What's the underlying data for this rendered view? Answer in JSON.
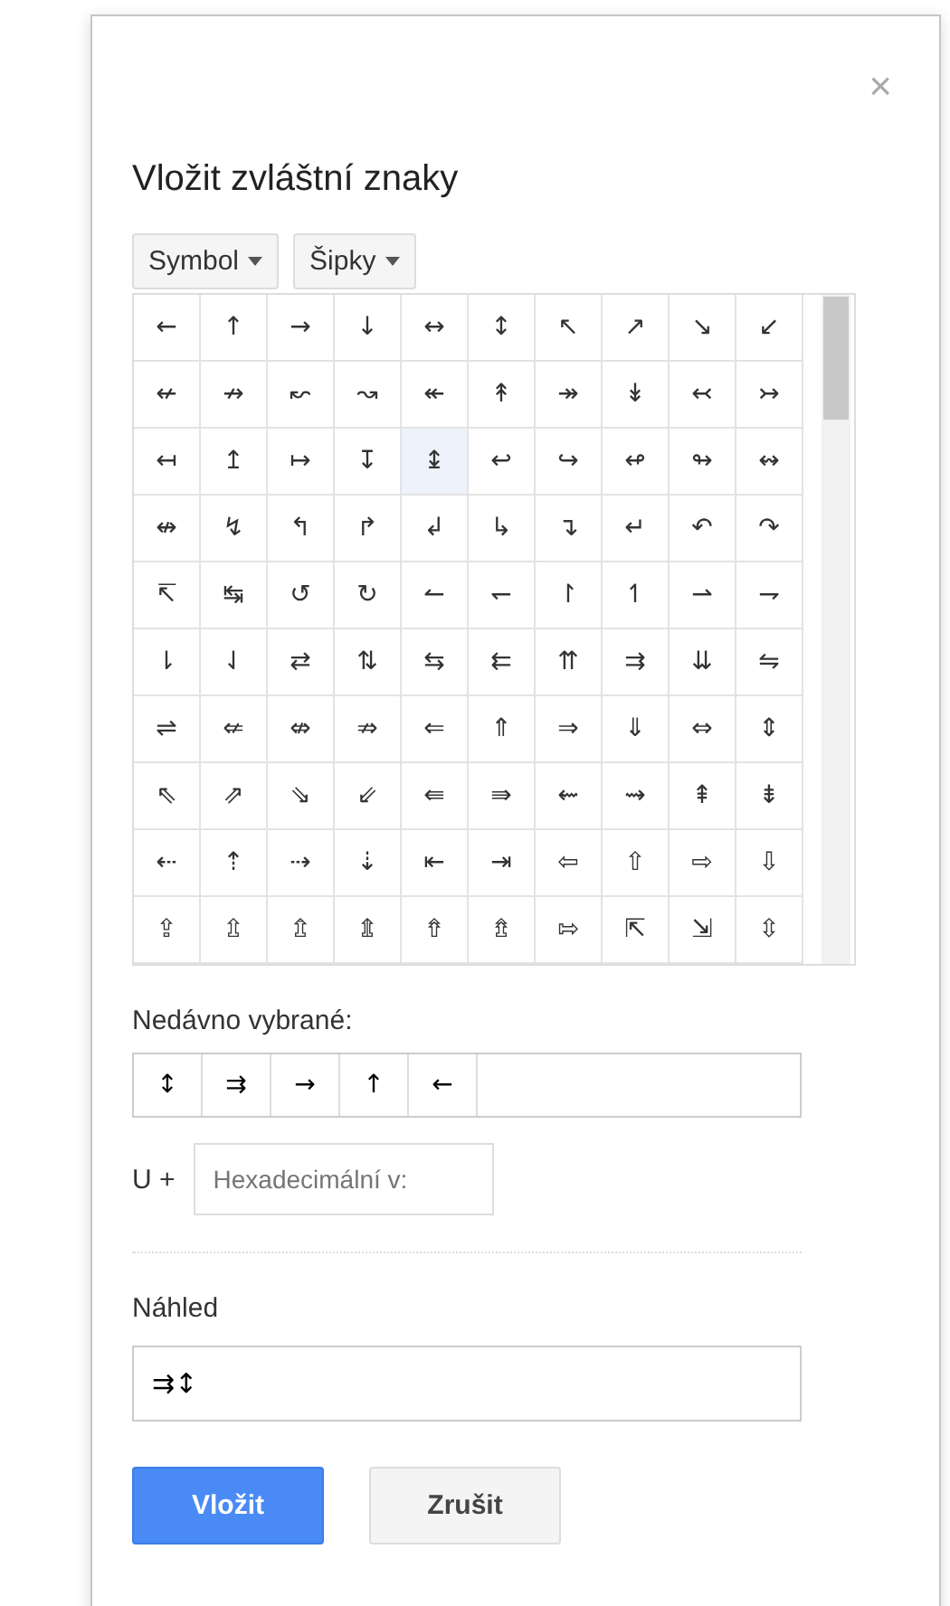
{
  "dialog": {
    "title": "Vložit zvláštní znaky",
    "close": "×"
  },
  "dropdowns": [
    {
      "label": "Symbol"
    },
    {
      "label": "Šipky"
    }
  ],
  "grid": [
    [
      {
        "char": "←",
        "selected": false
      },
      {
        "char": "↑",
        "selected": false
      },
      {
        "char": "→",
        "selected": false
      },
      {
        "char": "↓",
        "selected": false
      },
      {
        "char": "↔",
        "selected": false
      },
      {
        "char": "↕",
        "selected": false
      },
      {
        "char": "↖",
        "selected": false
      },
      {
        "char": "↗",
        "selected": false
      },
      {
        "char": "↘",
        "selected": false
      },
      {
        "char": "↙",
        "selected": false
      }
    ],
    [
      {
        "char": "↚",
        "selected": false
      },
      {
        "char": "↛",
        "selected": false
      },
      {
        "char": "↜",
        "selected": false
      },
      {
        "char": "↝",
        "selected": false
      },
      {
        "char": "↞",
        "selected": false
      },
      {
        "char": "↟",
        "selected": false
      },
      {
        "char": "↠",
        "selected": false
      },
      {
        "char": "↡",
        "selected": false
      },
      {
        "char": "↢",
        "selected": false
      },
      {
        "char": "↣",
        "selected": false
      }
    ],
    [
      {
        "char": "↤",
        "selected": false
      },
      {
        "char": "↥",
        "selected": false
      },
      {
        "char": "↦",
        "selected": false
      },
      {
        "char": "↧",
        "selected": false
      },
      {
        "char": "↨",
        "selected": true
      },
      {
        "char": "↩",
        "selected": false
      },
      {
        "char": "↪",
        "selected": false
      },
      {
        "char": "↫",
        "selected": false
      },
      {
        "char": "↬",
        "selected": false
      },
      {
        "char": "↭",
        "selected": false
      }
    ],
    [
      {
        "char": "↮",
        "selected": false
      },
      {
        "char": "↯",
        "selected": false
      },
      {
        "char": "↰",
        "selected": false
      },
      {
        "char": "↱",
        "selected": false
      },
      {
        "char": "↲",
        "selected": false
      },
      {
        "char": "↳",
        "selected": false
      },
      {
        "char": "↴",
        "selected": false
      },
      {
        "char": "↵",
        "selected": false
      },
      {
        "char": "↶",
        "selected": false
      },
      {
        "char": "↷",
        "selected": false
      }
    ],
    [
      {
        "char": "↸",
        "selected": false
      },
      {
        "char": "↹",
        "selected": false
      },
      {
        "char": "↺",
        "selected": false
      },
      {
        "char": "↻",
        "selected": false
      },
      {
        "char": "↼",
        "selected": false
      },
      {
        "char": "↽",
        "selected": false
      },
      {
        "char": "↾",
        "selected": false
      },
      {
        "char": "↿",
        "selected": false
      },
      {
        "char": "⇀",
        "selected": false
      },
      {
        "char": "⇁",
        "selected": false
      }
    ],
    [
      {
        "char": "⇂",
        "selected": false
      },
      {
        "char": "⇃",
        "selected": false
      },
      {
        "char": "⇄",
        "selected": false
      },
      {
        "char": "⇅",
        "selected": false
      },
      {
        "char": "⇆",
        "selected": false
      },
      {
        "char": "⇇",
        "selected": false
      },
      {
        "char": "⇈",
        "selected": false
      },
      {
        "char": "⇉",
        "selected": false
      },
      {
        "char": "⇊",
        "selected": false
      },
      {
        "char": "⇋",
        "selected": false
      }
    ],
    [
      {
        "char": "⇌",
        "selected": false
      },
      {
        "char": "⇍",
        "selected": false
      },
      {
        "char": "⇎",
        "selected": false
      },
      {
        "char": "⇏",
        "selected": false
      },
      {
        "char": "⇐",
        "selected": false
      },
      {
        "char": "⇑",
        "selected": false
      },
      {
        "char": "⇒",
        "selected": false
      },
      {
        "char": "⇓",
        "selected": false
      },
      {
        "char": "⇔",
        "selected": false
      },
      {
        "char": "⇕",
        "selected": false
      }
    ],
    [
      {
        "char": "⇖",
        "selected": false
      },
      {
        "char": "⇗",
        "selected": false
      },
      {
        "char": "⇘",
        "selected": false
      },
      {
        "char": "⇙",
        "selected": false
      },
      {
        "char": "⇚",
        "selected": false
      },
      {
        "char": "⇛",
        "selected": false
      },
      {
        "char": "⇜",
        "selected": false
      },
      {
        "char": "⇝",
        "selected": false
      },
      {
        "char": "⇞",
        "selected": false
      },
      {
        "char": "⇟",
        "selected": false
      }
    ],
    [
      {
        "char": "⇠",
        "selected": false
      },
      {
        "char": "⇡",
        "selected": false
      },
      {
        "char": "⇢",
        "selected": false
      },
      {
        "char": "⇣",
        "selected": false
      },
      {
        "char": "⇤",
        "selected": false
      },
      {
        "char": "⇥",
        "selected": false
      },
      {
        "char": "⇦",
        "selected": false
      },
      {
        "char": "⇧",
        "selected": false
      },
      {
        "char": "⇨",
        "selected": false
      },
      {
        "char": "⇩",
        "selected": false
      }
    ],
    [
      {
        "char": "⇪",
        "selected": false
      },
      {
        "char": "⇫",
        "selected": false
      },
      {
        "char": "⇬",
        "selected": false
      },
      {
        "char": "⇭",
        "selected": false
      },
      {
        "char": "⇮",
        "selected": false
      },
      {
        "char": "⇯",
        "selected": false
      },
      {
        "char": "⇰",
        "selected": false
      },
      {
        "char": "⇱",
        "selected": false
      },
      {
        "char": "⇲",
        "selected": false
      },
      {
        "char": "⇳",
        "selected": false
      }
    ]
  ],
  "recent": {
    "label": "Nedávno vybrané:",
    "chars": [
      "↕",
      "⇉",
      "→",
      "↑",
      "←"
    ]
  },
  "unicode": {
    "label": "U +",
    "placeholder": "Hexadecimální v:"
  },
  "preview": {
    "label": "Náhled",
    "value": "⇉↕"
  },
  "buttons": [
    {
      "label": "Vložit",
      "kind": "primary"
    },
    {
      "label": "Zrušit",
      "kind": "secondary"
    }
  ]
}
